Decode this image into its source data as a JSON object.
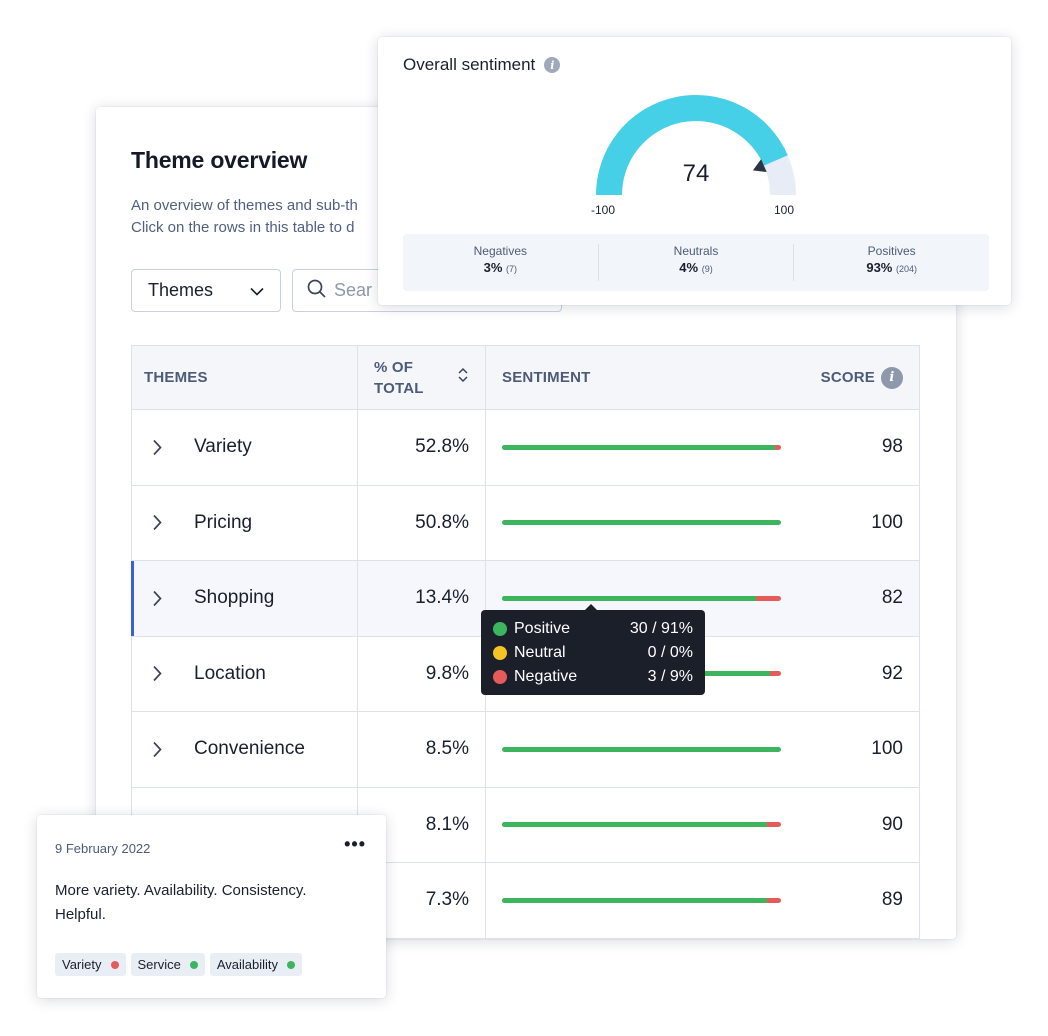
{
  "theme_overview": {
    "title": "Theme overview",
    "description_line1": "An overview of themes and sub-th",
    "description_line2": "Click on the rows in this table to d",
    "filter_select": {
      "value": "Themes",
      "icon": "chevron-down-icon"
    },
    "search": {
      "placeholder": "Sear",
      "icon": "search-icon"
    },
    "table": {
      "headers": {
        "themes": "THEMES",
        "pct_line1": "% OF",
        "pct_line2": "TOTAL",
        "sentiment": "SENTIMENT",
        "score": "SCORE"
      },
      "rows": [
        {
          "theme": "Variety",
          "pct": "52.8%",
          "positive": 0.98,
          "neutral": 0,
          "negative": 0.02,
          "score": "98"
        },
        {
          "theme": "Pricing",
          "pct": "50.8%",
          "positive": 1.0,
          "neutral": 0,
          "negative": 0,
          "score": "100"
        },
        {
          "theme": "Shopping",
          "pct": "13.4%",
          "positive": 0.91,
          "neutral": 0,
          "negative": 0.09,
          "score": "82",
          "highlighted": true
        },
        {
          "theme": "Location",
          "pct": "9.8%",
          "positive": 0.96,
          "neutral": 0,
          "negative": 0.04,
          "score": "92"
        },
        {
          "theme": "Convenience",
          "pct": "8.5%",
          "positive": 1.0,
          "neutral": 0,
          "negative": 0,
          "score": "100"
        },
        {
          "theme": "",
          "pct": "8.1%",
          "positive": 0.95,
          "neutral": 0,
          "negative": 0.05,
          "score": "90"
        },
        {
          "theme": "",
          "pct": "7.3%",
          "positive": 0.95,
          "neutral": 0,
          "negative": 0.05,
          "score": "89"
        }
      ]
    }
  },
  "overall_sentiment": {
    "title": "Overall sentiment",
    "gauge": {
      "value": 74,
      "display": "74",
      "min": -100,
      "max": 100,
      "min_label": "-100",
      "max_label": "100"
    },
    "stats": [
      {
        "label": "Negatives",
        "value": "3%",
        "count": "(7)"
      },
      {
        "label": "Neutrals",
        "value": "4%",
        "count": "(9)"
      },
      {
        "label": "Positives",
        "value": "93%",
        "count": "(204)"
      }
    ]
  },
  "tooltip": {
    "rows": [
      {
        "label": "Positive",
        "value": "30 / 91%"
      },
      {
        "label": "Neutral",
        "value": "0 / 0%"
      },
      {
        "label": "Negative",
        "value": "3 / 9%"
      }
    ]
  },
  "feedback": {
    "date": "9 February 2022",
    "more": "•••",
    "text": "More variety. Availability. Consistency. Helpful.",
    "tags": [
      {
        "label": "Variety",
        "sentiment": "negative"
      },
      {
        "label": "Service",
        "sentiment": "positive"
      },
      {
        "label": "Availability",
        "sentiment": "positive"
      }
    ]
  },
  "colors": {
    "positive": "#3cb55e",
    "neutral": "#f6c324",
    "negative": "#e65a5a",
    "gauge_fill": "#45d0e8",
    "gauge_track": "#e8ecf6",
    "accent": "#3b5fd9"
  }
}
